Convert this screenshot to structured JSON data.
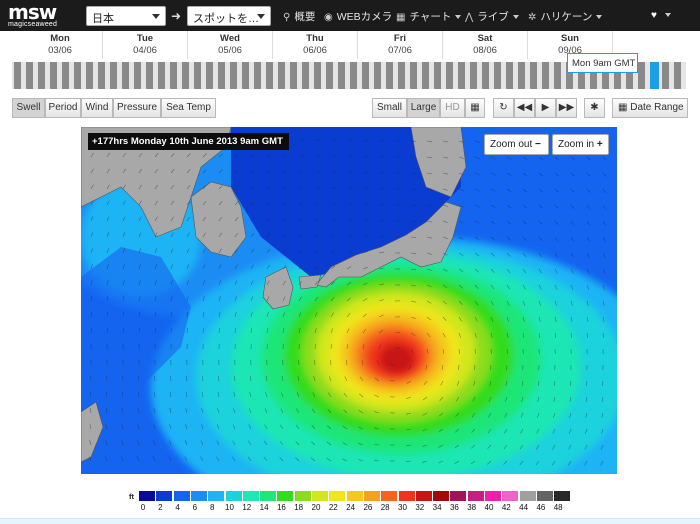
{
  "header": {
    "logo_text": "msw",
    "logo_sub": "magicseaweed",
    "region_select": "日本",
    "spot_select": "スポットを…",
    "nav": [
      {
        "label": "概要",
        "icon": "pin-icon"
      },
      {
        "label": "WEBカメラ",
        "icon": "webcam-icon"
      },
      {
        "label": "チャート",
        "icon": "grid-icon"
      },
      {
        "label": "ライブ",
        "icon": "activity-icon"
      },
      {
        "label": "ハリケーン",
        "icon": "hurricane-icon"
      }
    ]
  },
  "days": [
    {
      "name": "Mon",
      "date": "03/06"
    },
    {
      "name": "Tue",
      "date": "04/06"
    },
    {
      "name": "Wed",
      "date": "05/06"
    },
    {
      "name": "Thu",
      "date": "06/06"
    },
    {
      "name": "Fri",
      "date": "07/06"
    },
    {
      "name": "Sat",
      "date": "08/06"
    },
    {
      "name": "Sun",
      "date": "09/06"
    }
  ],
  "timeline": {
    "tooltip": "Mon 9am GMT"
  },
  "chart_tabs": [
    "Swell",
    "Period",
    "Wind",
    "Pressure",
    "Sea Temp"
  ],
  "active_tab": "Swell",
  "sizes": [
    "Small",
    "Large",
    "HD"
  ],
  "active_size": "Large",
  "date_range_label": "Date Range",
  "map": {
    "timestamp": "+177hrs Monday 10th June 2013 9am GMT",
    "zoom_out": "Zoom out",
    "zoom_in": "Zoom in"
  },
  "legend": {
    "unit": "ft",
    "items": [
      {
        "value": "0",
        "color": "#0a0a9a"
      },
      {
        "value": "2",
        "color": "#0a3cd2"
      },
      {
        "value": "4",
        "color": "#1464f0"
      },
      {
        "value": "6",
        "color": "#1e8cf5"
      },
      {
        "value": "8",
        "color": "#1eb4f5"
      },
      {
        "value": "10",
        "color": "#1ed2dc"
      },
      {
        "value": "12",
        "color": "#1ee6b4"
      },
      {
        "value": "14",
        "color": "#1ee678"
      },
      {
        "value": "16",
        "color": "#32dc1e"
      },
      {
        "value": "18",
        "color": "#8cdc1e"
      },
      {
        "value": "20",
        "color": "#d2e61e"
      },
      {
        "value": "22",
        "color": "#f0e61e"
      },
      {
        "value": "24",
        "color": "#f5c81e"
      },
      {
        "value": "26",
        "color": "#f5a01e"
      },
      {
        "value": "28",
        "color": "#f5641e"
      },
      {
        "value": "30",
        "color": "#f0321e"
      },
      {
        "value": "32",
        "color": "#c81414"
      },
      {
        "value": "34",
        "color": "#a00a0a"
      },
      {
        "value": "36",
        "color": "#a0145a"
      },
      {
        "value": "38",
        "color": "#c81e82"
      },
      {
        "value": "40",
        "color": "#f01eaa"
      },
      {
        "value": "42",
        "color": "#f064c8"
      },
      {
        "value": "44",
        "color": "#a0a0a0"
      },
      {
        "value": "46",
        "color": "#646464"
      },
      {
        "value": "48",
        "color": "#282828"
      }
    ]
  }
}
